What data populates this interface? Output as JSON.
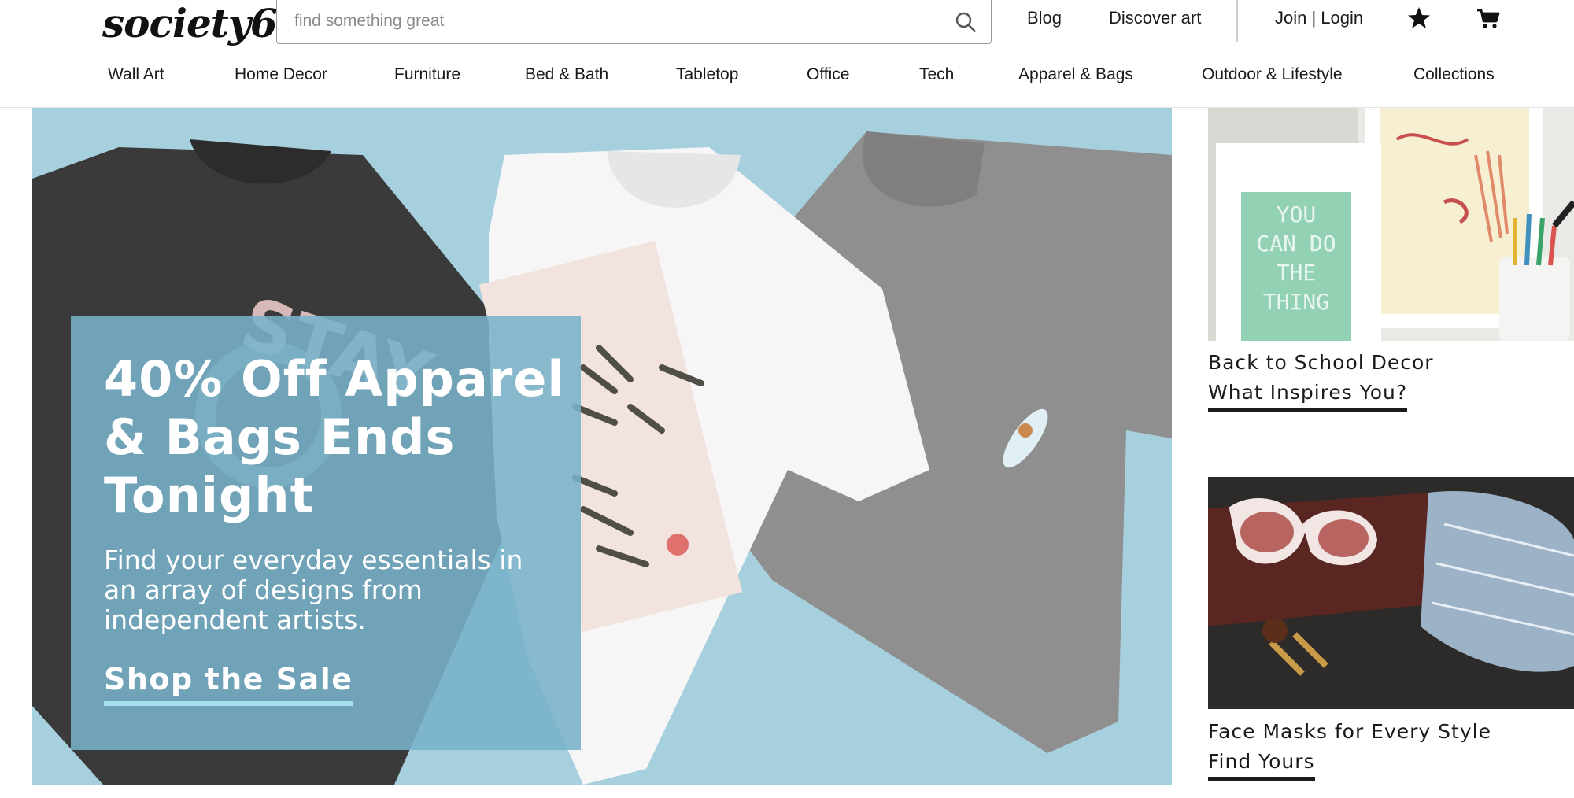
{
  "header": {
    "logo": "society6",
    "search": {
      "placeholder": "find something great",
      "value": ""
    },
    "links": {
      "blog": "Blog",
      "discover": "Discover art",
      "account": "Join | Login"
    },
    "icons": {
      "search": "search-icon",
      "wishlist": "star-icon",
      "cart": "cart-icon"
    }
  },
  "nav": {
    "items": [
      "Wall Art",
      "Home Decor",
      "Furniture",
      "Bed & Bath",
      "Tabletop",
      "Office",
      "Tech",
      "Apparel & Bags",
      "Outdoor & Lifestyle",
      "Collections"
    ]
  },
  "hero": {
    "title": "40% Off Apparel & Bags Ends Tonight",
    "subtitle": "Find your everyday essentials in an array of designs from independent artists.",
    "cta": "Shop the Sale",
    "shirt_text": "STAY",
    "poster_text": [
      "YOU",
      "CAN DO",
      "THE",
      "THING"
    ]
  },
  "cards": [
    {
      "title": "Back to School Decor",
      "link": "What Inspires You?"
    },
    {
      "title": "Face Masks for Every Style",
      "link": "Find Yours"
    }
  ],
  "colors": {
    "hero_bg": "#a7d0de",
    "promo_overlay": "#78b2ca",
    "cta_underline": "#a5e0ec",
    "text_dark": "#1a1a1a"
  }
}
